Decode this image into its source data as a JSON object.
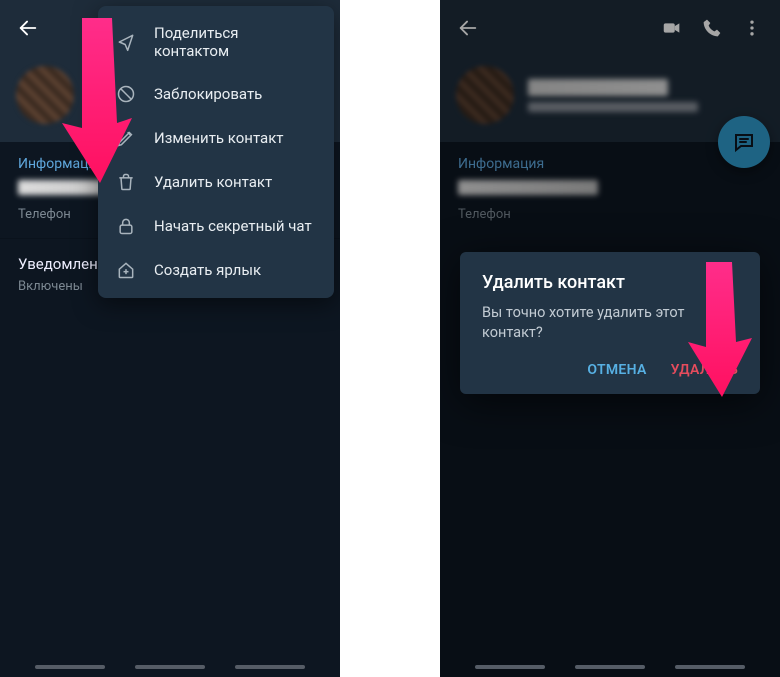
{
  "left": {
    "section_info": "Информация",
    "phone_label": "Телефон",
    "notif_title": "Уведомления",
    "notif_value": "Включены",
    "menu": {
      "share": "Поделиться контактом",
      "block": "Заблокировать",
      "edit": "Изменить контакт",
      "delete": "Удалить контакт",
      "secret": "Начать секретный чат",
      "shortcut": "Создать ярлык"
    }
  },
  "right": {
    "section_info": "Информация",
    "phone_label": "Телефон",
    "dialog": {
      "title": "Удалить контакт",
      "body": "Вы точно хотите удалить этот контакт?",
      "cancel": "ОТМЕНА",
      "delete": "УДАЛИТЬ"
    }
  }
}
